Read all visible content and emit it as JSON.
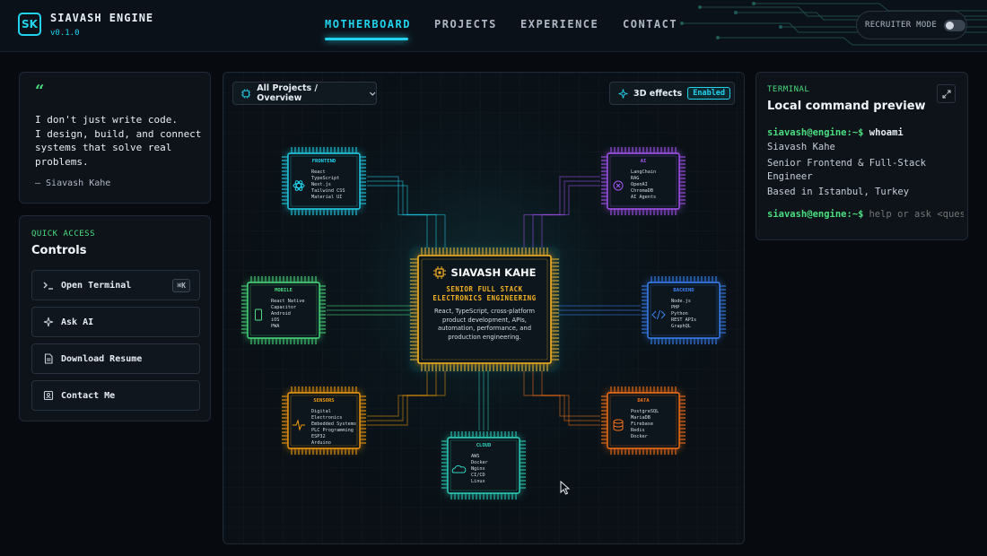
{
  "brand": {
    "logo": "SK",
    "title": "SIAVASH ENGINE",
    "version": "v0.1.0"
  },
  "nav": [
    {
      "label": "MOTHERBOARD",
      "active": true
    },
    {
      "label": "PROJECTS",
      "active": false
    },
    {
      "label": "EXPERIENCE",
      "active": false
    },
    {
      "label": "CONTACT",
      "active": false
    }
  ],
  "recruiter": {
    "label": "RECRUITER MODE",
    "on": false
  },
  "quote": {
    "mark": "“",
    "text": "I don't just write code.\nI design, build, and connect systems that solve real problems.",
    "author": "— Siavash Kahe"
  },
  "controls": {
    "kicker": "QUICK ACCESS",
    "title": "Controls",
    "buttons": [
      {
        "icon": "terminal-icon",
        "label": "Open Terminal",
        "shortcut": "⌘K"
      },
      {
        "icon": "sparkle-icon",
        "label": "Ask AI"
      },
      {
        "icon": "document-icon",
        "label": "Download Resume"
      },
      {
        "icon": "contact-card-icon",
        "label": "Contact Me"
      }
    ]
  },
  "board": {
    "selector": "All Projects / Overview",
    "effects_label": "3D effects",
    "effects_state": "Enabled",
    "cpu": {
      "name": "SIAVASH KAHE",
      "role_line1": "SENIOR FULL STACK",
      "role_line2": "ELECTRONICS ENGINEERING",
      "desc": [
        "React, TypeScript, cross-platform",
        "product development, APIs,",
        "automation, performance, and",
        "production engineering."
      ]
    },
    "chips": [
      {
        "id": "frontend",
        "title": "FRONTEND",
        "color": "#22d3ee",
        "icon": "atom-icon",
        "items": [
          "React",
          "TypeScript",
          "Next.js",
          "Tailwind CSS",
          "Material UI"
        ]
      },
      {
        "id": "ai",
        "title": "AI",
        "color": "#a855f7",
        "icon": "ai-brain-icon",
        "items": [
          "LangChain",
          "RAG",
          "OpenAI",
          "ChromaDB",
          "AI Agents"
        ]
      },
      {
        "id": "mobile",
        "title": "MOBILE",
        "color": "#4ade80",
        "icon": "phone-icon",
        "items": [
          "React Native",
          "Capacitor",
          "Android",
          "iOS",
          "PWA"
        ]
      },
      {
        "id": "backend",
        "title": "BACKEND",
        "color": "#3b82f6",
        "icon": "code-icon",
        "items": [
          "Node.js",
          "PHP",
          "Python",
          "REST APIs",
          "GraphQL"
        ]
      },
      {
        "id": "sensors",
        "title": "SENSORS",
        "color": "#f59e0b",
        "icon": "pulse-icon",
        "items": [
          "Digital",
          "Electronics",
          "Embedded Systems",
          "PLC Programming",
          "ESP32",
          "Arduino"
        ]
      },
      {
        "id": "data",
        "title": "DATA",
        "color": "#f97316",
        "icon": "database-icon",
        "items": [
          "PostgreSQL",
          "MariaDB",
          "Firebase",
          "Redis",
          "Docker"
        ]
      },
      {
        "id": "cloud",
        "title": "CLOUD",
        "color": "#2dd4bf",
        "icon": "cloud-icon",
        "items": [
          "AWS",
          "Docker",
          "Nginx",
          "CI/CD",
          "Linux"
        ]
      }
    ]
  },
  "terminal": {
    "kicker": "TERMINAL",
    "title": "Local command preview",
    "prompt": "siavash@engine:~$",
    "command": "whoami",
    "output": [
      "Siavash Kahe",
      "Senior Frontend & Full-Stack Engineer",
      "Based in Istanbul, Turkey"
    ],
    "placeholder": "help or ask <question>"
  }
}
